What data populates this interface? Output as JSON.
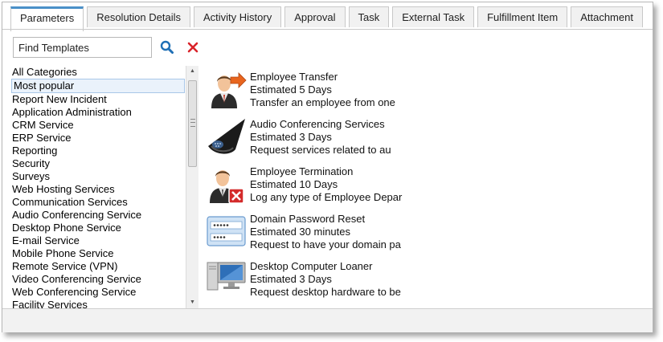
{
  "tabs": [
    {
      "label": "Parameters",
      "active": true
    },
    {
      "label": "Resolution Details"
    },
    {
      "label": "Activity History"
    },
    {
      "label": "Approval"
    },
    {
      "label": "Task"
    },
    {
      "label": "External Task"
    },
    {
      "label": "Fulfillment Item"
    },
    {
      "label": "Attachment"
    }
  ],
  "search": {
    "value": "Find Templates",
    "search_icon": "search-icon",
    "clear_icon": "close-icon"
  },
  "categories": [
    "All Categories",
    "Most popular",
    "Report New Incident",
    "Application Administration",
    "CRM Service",
    "ERP Service",
    "Reporting",
    "Security",
    "Surveys",
    "Web Hosting Services",
    "Communication Services",
    "Audio Conferencing Service",
    "Desktop Phone Service",
    "E-mail Service",
    "Mobile Phone Service",
    "Remote Service (VPN)",
    "Video Conferencing Service",
    "Web Conferencing Service",
    "Facility Services"
  ],
  "selected_category": "Most popular",
  "templates": [
    {
      "title": "Employee Transfer",
      "estimate": "Estimated 5 Days",
      "description": "Transfer an employee from one",
      "icon": "employee-transfer-icon"
    },
    {
      "title": "Audio Conferencing Services",
      "estimate": "Estimated 3 Days",
      "description": "Request services related to au",
      "icon": "conference-phone-icon"
    },
    {
      "title": "Employee Termination",
      "estimate": "Estimated 10 Days",
      "description": "Log any type of Employee Depar",
      "icon": "employee-termination-icon"
    },
    {
      "title": "Domain Password Reset",
      "estimate": "Estimated 30 minutes",
      "description": "Request to have your domain pa",
      "icon": "password-field-icon"
    },
    {
      "title": "Desktop Computer Loaner",
      "estimate": "Estimated 3 Days",
      "description": "Request desktop hardware to be",
      "icon": "desktop-computer-icon"
    }
  ],
  "colors": {
    "accent": "#4a90c8",
    "search_icon": "#1f6fb5",
    "clear_icon": "#d9232a",
    "selection": "#eaf2fb"
  }
}
